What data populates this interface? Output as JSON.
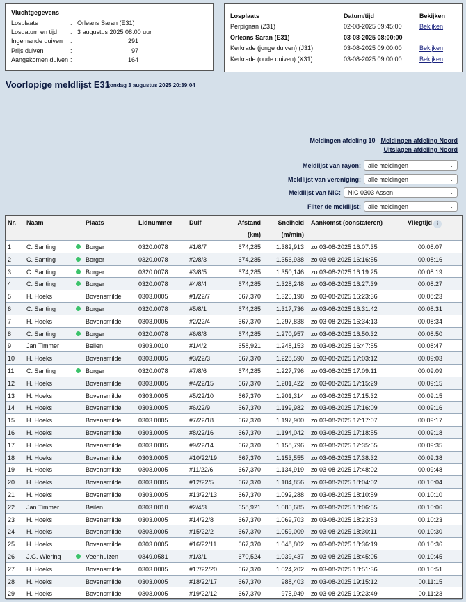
{
  "flight": {
    "title": "Vluchtgegevens",
    "rows": [
      {
        "label": "Losplaats",
        "value": "Orleans Saran (E31)"
      },
      {
        "label": "Losdatum en tijd",
        "value": "3 augustus 2025 08:00 uur"
      },
      {
        "label": "Ingemande duiven",
        "value": "291"
      },
      {
        "label": "Prijs duiven",
        "value": "97"
      },
      {
        "label": "Aangekomen duiven",
        "value": "164"
      }
    ]
  },
  "races": {
    "headers": [
      "Losplaats",
      "Datum/tijd",
      "Bekijken"
    ],
    "rows": [
      {
        "place": "Perpignan (Z31)",
        "date": "02-08-2025 09:45:00",
        "link": "Bekijken"
      },
      {
        "place": "Orleans Saran (E31)",
        "date": "03-08-2025 08:00:00",
        "link": ""
      },
      {
        "place": "Kerkrade (jonge duiven) (J31)",
        "date": "03-08-2025 09:00:00",
        "link": "Bekijken"
      },
      {
        "place": "Kerkrade (oude duiven) (X31)",
        "date": "03-08-2025 09:00:00",
        "link": "Bekijken"
      }
    ]
  },
  "page": {
    "title": "Voorlopige meldlijst E31",
    "subtitle": "zondag 3 augustus 2025 20:39:04"
  },
  "links": {
    "label": "Meldingen afdeling 10",
    "link1": "Meldingen afdeling Noord",
    "link2": "Uitslagen afdeling Noord"
  },
  "filters": [
    {
      "label": "Meldlijst van rayon:",
      "value": "alle meldingen"
    },
    {
      "label": "Meldlijst van vereniging:",
      "value": "alle meldingen"
    },
    {
      "label": "Meldlijst van NIC:",
      "value": "NIC 0303 Assen"
    },
    {
      "label": "Filter de meldlijst:",
      "value": "alle meldingen"
    }
  ],
  "table": {
    "headers": {
      "nr": "Nr.",
      "naam": "Naam",
      "plaats": "Plaats",
      "lid": "Lidnummer",
      "duif": "Duif",
      "afstand": "Afstand",
      "afstand_unit": "(km)",
      "snelheid": "Snelheid",
      "snelheid_unit": "(m/min)",
      "aankomst": "Aankomst (constateren)",
      "vliegtijd": "Vliegtijd",
      "info": "i"
    },
    "rows": [
      [
        "1",
        "C. Santing",
        true,
        "Borger",
        "0320.0078",
        "#1/8/7",
        "674,285",
        "1.382,913",
        "zo 03-08-2025 16:07:35",
        "00.08:07"
      ],
      [
        "2",
        "C. Santing",
        true,
        "Borger",
        "0320.0078",
        "#2/8/3",
        "674,285",
        "1.356,938",
        "zo 03-08-2025 16:16:55",
        "00.08:16"
      ],
      [
        "3",
        "C. Santing",
        true,
        "Borger",
        "0320.0078",
        "#3/8/5",
        "674,285",
        "1.350,146",
        "zo 03-08-2025 16:19:25",
        "00.08:19"
      ],
      [
        "4",
        "C. Santing",
        true,
        "Borger",
        "0320.0078",
        "#4/8/4",
        "674,285",
        "1.328,248",
        "zo 03-08-2025 16:27:39",
        "00.08:27"
      ],
      [
        "5",
        "H. Hoeks",
        false,
        "Bovensmilde",
        "0303.0005",
        "#1/22/7",
        "667,370",
        "1.325,198",
        "zo 03-08-2025 16:23:36",
        "00.08:23"
      ],
      [
        "6",
        "C. Santing",
        true,
        "Borger",
        "0320.0078",
        "#5/8/1",
        "674,285",
        "1.317,736",
        "zo 03-08-2025 16:31:42",
        "00.08:31"
      ],
      [
        "7",
        "H. Hoeks",
        false,
        "Bovensmilde",
        "0303.0005",
        "#2/22/4",
        "667,370",
        "1.297,838",
        "zo 03-08-2025 16:34:13",
        "00.08:34"
      ],
      [
        "8",
        "C. Santing",
        true,
        "Borger",
        "0320.0078",
        "#6/8/8",
        "674,285",
        "1.270,957",
        "zo 03-08-2025 16:50:32",
        "00.08:50"
      ],
      [
        "9",
        "Jan Timmer",
        false,
        "Beilen",
        "0303.0010",
        "#1/4/2",
        "658,921",
        "1.248,153",
        "zo 03-08-2025 16:47:55",
        "00.08:47"
      ],
      [
        "10",
        "H. Hoeks",
        false,
        "Bovensmilde",
        "0303.0005",
        "#3/22/3",
        "667,370",
        "1.228,590",
        "zo 03-08-2025 17:03:12",
        "00.09:03"
      ],
      [
        "11",
        "C. Santing",
        true,
        "Borger",
        "0320.0078",
        "#7/8/6",
        "674,285",
        "1.227,796",
        "zo 03-08-2025 17:09:11",
        "00.09:09"
      ],
      [
        "12",
        "H. Hoeks",
        false,
        "Bovensmilde",
        "0303.0005",
        "#4/22/15",
        "667,370",
        "1.201,422",
        "zo 03-08-2025 17:15:29",
        "00.09:15"
      ],
      [
        "13",
        "H. Hoeks",
        false,
        "Bovensmilde",
        "0303.0005",
        "#5/22/10",
        "667,370",
        "1.201,314",
        "zo 03-08-2025 17:15:32",
        "00.09:15"
      ],
      [
        "14",
        "H. Hoeks",
        false,
        "Bovensmilde",
        "0303.0005",
        "#6/22/9",
        "667,370",
        "1.199,982",
        "zo 03-08-2025 17:16:09",
        "00.09:16"
      ],
      [
        "15",
        "H. Hoeks",
        false,
        "Bovensmilde",
        "0303.0005",
        "#7/22/18",
        "667,370",
        "1.197,900",
        "zo 03-08-2025 17:17:07",
        "00.09:17"
      ],
      [
        "16",
        "H. Hoeks",
        false,
        "Bovensmilde",
        "0303.0005",
        "#8/22/16",
        "667,370",
        "1.194,042",
        "zo 03-08-2025 17:18:55",
        "00.09:18"
      ],
      [
        "17",
        "H. Hoeks",
        false,
        "Bovensmilde",
        "0303.0005",
        "#9/22/14",
        "667,370",
        "1.158,796",
        "zo 03-08-2025 17:35:55",
        "00.09:35"
      ],
      [
        "18",
        "H. Hoeks",
        false,
        "Bovensmilde",
        "0303.0005",
        "#10/22/19",
        "667,370",
        "1.153,555",
        "zo 03-08-2025 17:38:32",
        "00.09:38"
      ],
      [
        "19",
        "H. Hoeks",
        false,
        "Bovensmilde",
        "0303.0005",
        "#11/22/6",
        "667,370",
        "1.134,919",
        "zo 03-08-2025 17:48:02",
        "00.09:48"
      ],
      [
        "20",
        "H. Hoeks",
        false,
        "Bovensmilde",
        "0303.0005",
        "#12/22/5",
        "667,370",
        "1.104,856",
        "zo 03-08-2025 18:04:02",
        "00.10:04"
      ],
      [
        "21",
        "H. Hoeks",
        false,
        "Bovensmilde",
        "0303.0005",
        "#13/22/13",
        "667,370",
        "1.092,288",
        "zo 03-08-2025 18:10:59",
        "00.10:10"
      ],
      [
        "22",
        "Jan Timmer",
        false,
        "Beilen",
        "0303.0010",
        "#2/4/3",
        "658,921",
        "1.085,685",
        "zo 03-08-2025 18:06:55",
        "00.10:06"
      ],
      [
        "23",
        "H. Hoeks",
        false,
        "Bovensmilde",
        "0303.0005",
        "#14/22/8",
        "667,370",
        "1.069,703",
        "zo 03-08-2025 18:23:53",
        "00.10:23"
      ],
      [
        "24",
        "H. Hoeks",
        false,
        "Bovensmilde",
        "0303.0005",
        "#15/22/2",
        "667,370",
        "1.059,009",
        "zo 03-08-2025 18:30:11",
        "00.10:30"
      ],
      [
        "25",
        "H. Hoeks",
        false,
        "Bovensmilde",
        "0303.0005",
        "#16/22/11",
        "667,370",
        "1.048,802",
        "zo 03-08-2025 18:36:19",
        "00.10:36"
      ],
      [
        "26",
        "J.G. Wiering",
        true,
        "Veenhuizen",
        "0349.0581",
        "#1/3/1",
        "670,524",
        "1.039,437",
        "zo 03-08-2025 18:45:05",
        "00.10:45"
      ],
      [
        "27",
        "H. Hoeks",
        false,
        "Bovensmilde",
        "0303.0005",
        "#17/22/20",
        "667,370",
        "1.024,202",
        "zo 03-08-2025 18:51:36",
        "00.10:51"
      ],
      [
        "28",
        "H. Hoeks",
        false,
        "Bovensmilde",
        "0303.0005",
        "#18/22/17",
        "667,370",
        "988,403",
        "zo 03-08-2025 19:15:12",
        "00.11:15"
      ],
      [
        "29",
        "H. Hoeks",
        false,
        "Bovensmilde",
        "0303.0005",
        "#19/22/12",
        "667,370",
        "975,949",
        "zo 03-08-2025 19:23:49",
        "00.11:23"
      ]
    ]
  }
}
